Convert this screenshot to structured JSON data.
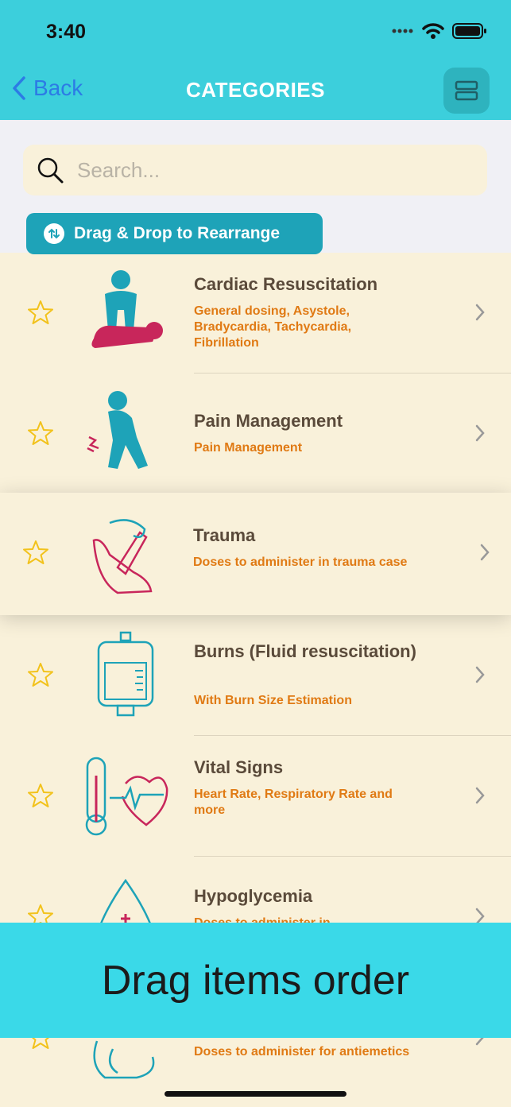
{
  "status": {
    "time": "3:40"
  },
  "nav": {
    "back_label": "Back",
    "title": "CATEGORIES"
  },
  "search": {
    "placeholder": "Search..."
  },
  "drag_button": {
    "label": "Drag & Drop to Rearrange"
  },
  "categories": [
    {
      "name": "Cardiac Resuscitation",
      "subtitle": "General dosing, Asystole, Bradycardia, Tachycardia, Fibrillation"
    },
    {
      "name": "Pain Management",
      "subtitle": "Pain Management"
    },
    {
      "name": "Trauma",
      "subtitle": "Doses to administer in trauma case"
    },
    {
      "name": "Burns (Fluid resuscitation)",
      "subtitle": "With Burn Size Estimation"
    },
    {
      "name": "Vital Signs",
      "subtitle": "Heart Rate, Respiratory Rate and more"
    },
    {
      "name": "Hypoglycemia",
      "subtitle": "Doses to administer in"
    },
    {
      "name": "",
      "subtitle": "Doses to administer for antiemetics"
    }
  ],
  "banner": {
    "text": "Drag items order"
  },
  "colors": {
    "header": "#3ccfdc",
    "accent": "#1ea3b8",
    "subtitle": "#e07a14",
    "star": "#f2c21b",
    "banner": "#3ad9e8"
  }
}
